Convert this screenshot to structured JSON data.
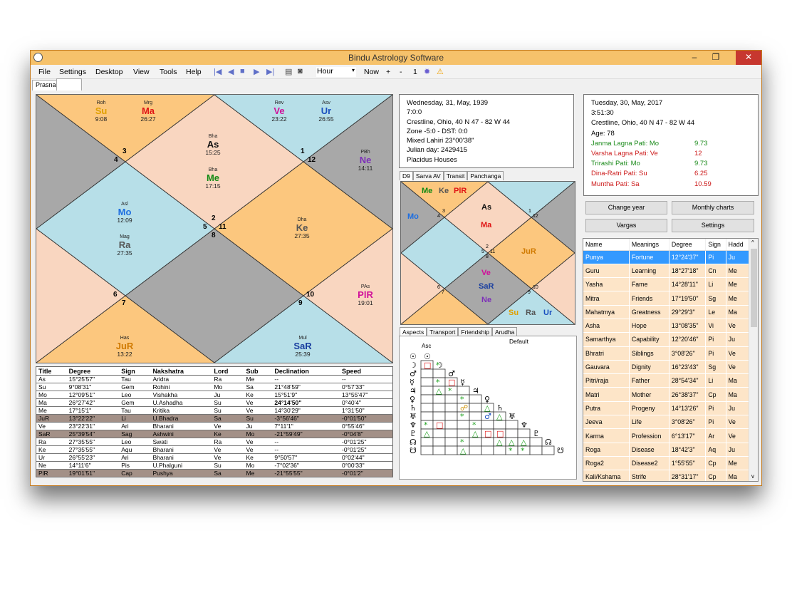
{
  "window": {
    "title": "Bindu Astrology Software",
    "min": "–",
    "restore": "❐",
    "close": "✕"
  },
  "menu": [
    "File",
    "Settings",
    "Desktop",
    "View",
    "Tools",
    "Help"
  ],
  "toolbar": {
    "hour_select": "Hour",
    "now_label": "Now",
    "plus": "+",
    "minus": "-",
    "step": "1",
    "dropdown_arrow": "▾"
  },
  "doc_tab": "Prasna",
  "main_chart": {
    "house_numbers": [
      "3",
      "4",
      "1",
      "12",
      "2",
      "5",
      "11",
      "8",
      "6",
      "7",
      "10",
      "9"
    ],
    "planets": [
      {
        "nak": "Roh",
        "sym": "Su",
        "deg": "9:08",
        "color": "#e0a000"
      },
      {
        "nak": "Mrg",
        "sym": "Ma",
        "deg": "26:27",
        "color": "#e01515"
      },
      {
        "nak": "Rev",
        "sym": "Ve",
        "deg": "23:22",
        "color": "#d0109a"
      },
      {
        "nak": "Asv",
        "sym": "Ur",
        "deg": "26:55",
        "color": "#1a4fbf"
      },
      {
        "nak": "Bha",
        "sym": "As",
        "deg": "15:25",
        "color": "#111"
      },
      {
        "nak": "Bha",
        "sym": "Me",
        "deg": "17:15",
        "color": "#138a13"
      },
      {
        "nak": "PBh",
        "sym": "Ne",
        "deg": "14:11",
        "color": "#7d2fb8"
      },
      {
        "nak": "Asl",
        "sym": "Mo",
        "deg": "12:09",
        "color": "#1f6fe0"
      },
      {
        "nak": "Mag",
        "sym": "Ra",
        "deg": "27:35",
        "color": "#555"
      },
      {
        "nak": "Dha",
        "sym": "Ke",
        "deg": "27:35",
        "color": "#555"
      },
      {
        "nak": "PAs",
        "sym": "PlR",
        "deg": "19:01",
        "color": "#d0109a"
      },
      {
        "nak": "Has",
        "sym": "JuR",
        "deg": "13:22",
        "color": "#d07a00"
      },
      {
        "nak": "Mul",
        "sym": "SaR",
        "deg": "25:39",
        "color": "#1a3fa0"
      }
    ]
  },
  "positions": {
    "headers": [
      "Title",
      "Degree",
      "Sign",
      "Nakshatra",
      "Lord",
      "Sub",
      "Declination",
      "Speed"
    ],
    "rows": [
      [
        "As",
        "15°25'57\"",
        "Tau",
        "Aridra",
        "Ra",
        "Me",
        "--",
        "--"
      ],
      [
        "Su",
        "9°08'31\"",
        "Gem",
        "Rohini",
        "Mo",
        "Sa",
        "21°48'59\"",
        "0°57'33\""
      ],
      [
        "Mo",
        "12°09'51\"",
        "Leo",
        "Vishakha",
        "Ju",
        "Ke",
        "15°51'9\"",
        "13°55'47\""
      ],
      [
        "Ma",
        "26°27'42\"",
        "Gem",
        "U.Ashadha",
        "Su",
        "Ve",
        "24°14'50\"",
        "0°40'4\""
      ],
      [
        "Me",
        "17°15'1\"",
        "Tau",
        "Kritika",
        "Su",
        "Ve",
        "14°30'29\"",
        "1°31'50\""
      ],
      [
        "JuR",
        "13°22'22\"",
        "Li",
        "U.Bhadra",
        "Sa",
        "Su",
        "-3°56'46\"",
        "-0°01'50\""
      ],
      [
        "Ve",
        "23°22'31\"",
        "Ari",
        "Bharani",
        "Ve",
        "Ju",
        "7°11'1\"",
        "0°55'46\""
      ],
      [
        "SaR",
        "25°39'54\"",
        "Sag",
        "Ashwini",
        "Ke",
        "Mo",
        "-21°59'49\"",
        "-0°04'8\""
      ],
      [
        "Ra",
        "27°35'55\"",
        "Leo",
        "Swati",
        "Ra",
        "Ve",
        "--",
        "-0°01'25\""
      ],
      [
        "Ke",
        "27°35'55\"",
        "Aqu",
        "Bharani",
        "Ve",
        "Ve",
        "--",
        "-0°01'25\""
      ],
      [
        "Ur",
        "26°55'23\"",
        "Ari",
        "Bharani",
        "Ve",
        "Ke",
        "9°50'57\"",
        "0°02'44\""
      ],
      [
        "Ne",
        "14°11'6\"",
        "Pis",
        "U.Phalguni",
        "Su",
        "Mo",
        "-7°02'36\"",
        "0°00'33\""
      ],
      [
        "PlR",
        "19°01'51\"",
        "Cap",
        "Pushya",
        "Sa",
        "Me",
        "-21°55'55\"",
        "-0°01'2\""
      ]
    ],
    "highlight_rows": [
      5,
      7,
      12
    ]
  },
  "birth_info": {
    "lines": [
      "Wednesday, 31, May, 1939",
      "7:0:0",
      "Crestline, Ohio,  40 N 47 - 82 W 44",
      "Zone -5:0 - DST: 0:0",
      "Mixed Lahiri 23°00'38\"",
      "Julian day: 2429415",
      "Placidus Houses"
    ]
  },
  "transit_info": {
    "lines": [
      "Tuesday, 30, May, 2017",
      "3:51:30",
      "Crestline, Ohio,  40 N 47 - 82 W 44",
      "Age: 78"
    ],
    "patis": [
      {
        "label": "Janma Lagna Pati: Mo",
        "value": "9.73",
        "color": "g"
      },
      {
        "label": "Varsha Lagna Pati: Ve",
        "value": "12",
        "color": "r"
      },
      {
        "label": "Trirashi Pati: Mo",
        "value": "9.73",
        "color": "g"
      },
      {
        "label": "Dina-Ratri Pati: Su",
        "value": "6.25",
        "color": "r"
      },
      {
        "label": "Muntha Pati: Sa",
        "value": "10.59",
        "color": "r"
      }
    ]
  },
  "varga_tabs": [
    "D9",
    "Sarva AV",
    "Transit",
    "Panchanga"
  ],
  "d9_chart": {
    "house_numbers": [
      "3",
      "4",
      "1",
      "12",
      "2",
      "5",
      "11",
      "8",
      "6",
      "7",
      "10",
      "9"
    ],
    "planets": [
      {
        "sym": "Me",
        "color": "#138a13"
      },
      {
        "sym": "Ke",
        "color": "#555"
      },
      {
        "sym": "PlR",
        "color": "#e01515"
      },
      {
        "sym": "Mo",
        "color": "#1f6fe0"
      },
      {
        "sym": "As",
        "color": "#111"
      },
      {
        "sym": "Ma",
        "color": "#e01515"
      },
      {
        "sym": "JuR",
        "color": "#d07a00"
      },
      {
        "sym": "Ve",
        "color": "#d0109a"
      },
      {
        "sym": "SaR",
        "color": "#1a3fa0"
      },
      {
        "sym": "Ne",
        "color": "#7d2fb8"
      },
      {
        "sym": "Su",
        "color": "#e0a000"
      },
      {
        "sym": "Ra",
        "color": "#555"
      },
      {
        "sym": "Ur",
        "color": "#1a4fbf"
      }
    ]
  },
  "aspect_tabs": [
    "Aspects",
    "Transport",
    "Friendship",
    "Arudha"
  ],
  "aspect_default": "Default",
  "aspect_top": "Asc",
  "aspect_symbols": [
    "☉",
    "☽",
    "♂",
    "☿",
    "♃",
    "♀",
    "♄",
    "♅",
    "♆",
    "♇",
    "☊",
    "☋"
  ],
  "buttons": {
    "change_year": "Change year",
    "monthly_charts": "Monthly charts",
    "vargas": "Vargas",
    "settings": "Settings"
  },
  "meanings": {
    "headers": [
      "Name",
      "Meanings",
      "Degree",
      "Sign",
      "Hadd"
    ],
    "sort_arrow": "^",
    "scroll_down": "v",
    "rows": [
      [
        "Punya",
        "Fortune",
        "12°24'37\"",
        "Pi",
        "Ju"
      ],
      [
        "Guru",
        "Learning",
        "18°27'18\"",
        "Cn",
        "Me"
      ],
      [
        "Yasha",
        "Fame",
        "14°28'11\"",
        "Li",
        "Me"
      ],
      [
        "Mitra",
        "Friends",
        "17°19'50\"",
        "Sg",
        "Me"
      ],
      [
        "Mahatmya",
        "Greatness",
        "29°29'3\"",
        "Le",
        "Ma"
      ],
      [
        "Asha",
        "Hope",
        "13°08'35\"",
        "Vi",
        "Ve"
      ],
      [
        "Samarthya",
        "Capability",
        "12°20'46\"",
        "Pi",
        "Ju"
      ],
      [
        "Bhratri",
        "Siblings",
        "3°08'26\"",
        "Pi",
        "Ve"
      ],
      [
        "Gauvara",
        "Dignity",
        "16°23'43\"",
        "Sg",
        "Ve"
      ],
      [
        "Pitri/raja",
        "Father",
        "28°54'34\"",
        "Li",
        "Ma"
      ],
      [
        "Matri",
        "Mother",
        "26°38'37\"",
        "Cp",
        "Ma"
      ],
      [
        "Putra",
        "Progeny",
        "14°13'26\"",
        "Pi",
        "Ju"
      ],
      [
        "Jeeva",
        "Life",
        "3°08'26\"",
        "Pi",
        "Ve"
      ],
      [
        "Karma",
        "Profession",
        "6°13'17\"",
        "Ar",
        "Ve"
      ],
      [
        "Roga",
        "Disease",
        "18°42'3\"",
        "Aq",
        "Ju"
      ],
      [
        "Roga2",
        "Disease2",
        "1°55'55\"",
        "Cp",
        "Me"
      ],
      [
        "Kali/Kshama",
        "Strife",
        "28°31'17\"",
        "Cp",
        "Ma"
      ]
    ]
  },
  "colors": {
    "title_bar": "#f6c26b",
    "peach": "#f9d6c0",
    "blue": "#b7dfe8",
    "gray": "#a8a8a8",
    "orange": "#fcc77e",
    "selection": "#3399ff"
  }
}
